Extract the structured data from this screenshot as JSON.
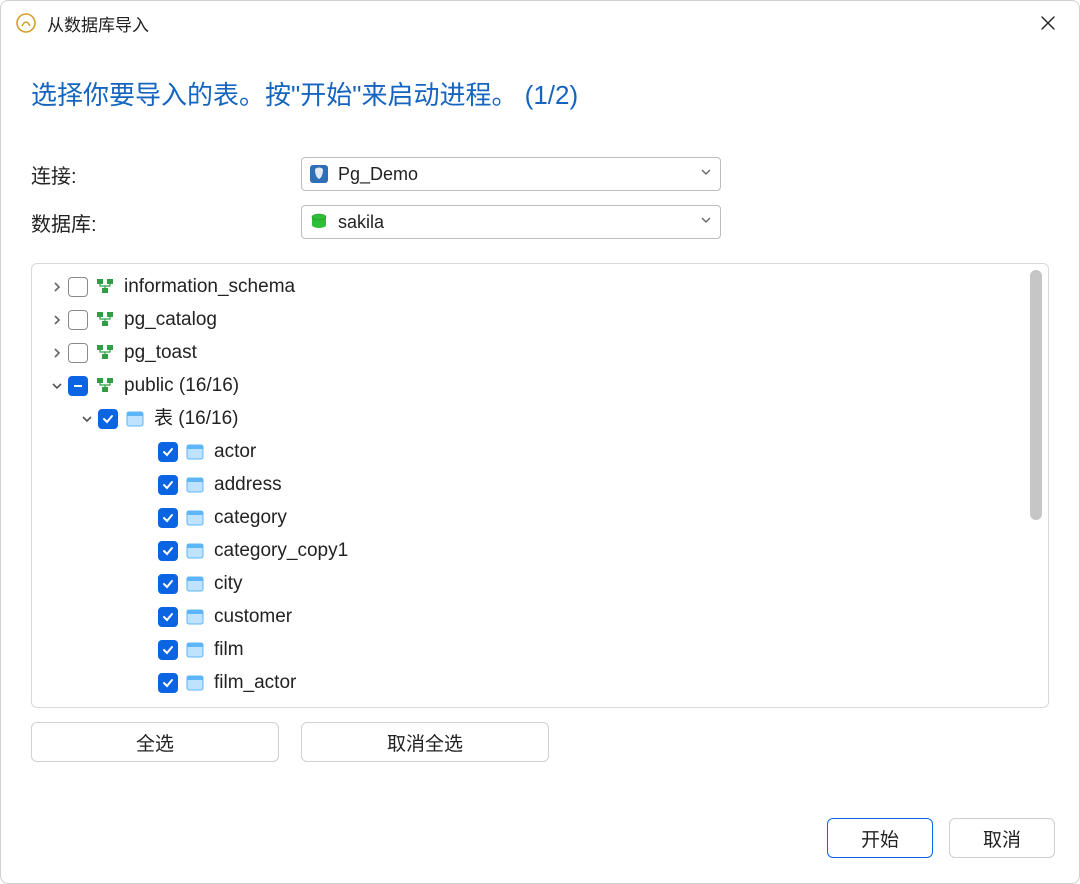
{
  "titlebar": {
    "title": "从数据库导入"
  },
  "heading": "选择你要导入的表。按\"开始\"来启动进程。 (1/2)",
  "form": {
    "connection_label": "连接:",
    "connection_value": "Pg_Demo",
    "database_label": "数据库:",
    "database_value": "sakila"
  },
  "tree": {
    "schemas": [
      {
        "name": "information_schema",
        "checked": false,
        "expanded": false
      },
      {
        "name": "pg_catalog",
        "checked": false,
        "expanded": false
      },
      {
        "name": "pg_toast",
        "checked": false,
        "expanded": false
      },
      {
        "name": "public (16/16)",
        "checked": "indeterminate",
        "expanded": true,
        "folder": {
          "label": "表 (16/16)",
          "checked": true,
          "expanded": true,
          "tables": [
            "actor",
            "address",
            "category",
            "category_copy1",
            "city",
            "customer",
            "film",
            "film_actor"
          ]
        }
      }
    ]
  },
  "buttons": {
    "select_all": "全选",
    "deselect_all": "取消全选",
    "start": "开始",
    "cancel": "取消"
  },
  "colors": {
    "accent": "#0b65e3",
    "heading": "#1565c0"
  }
}
